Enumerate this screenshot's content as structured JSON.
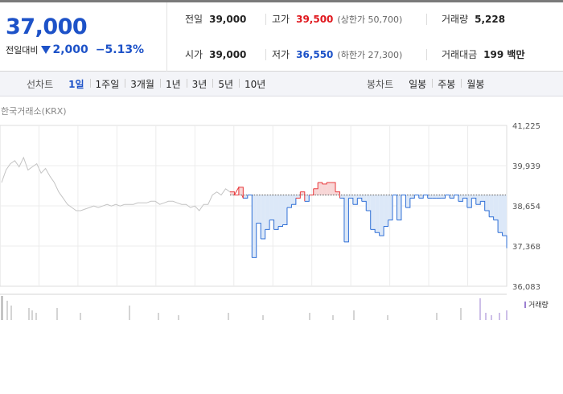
{
  "quote": {
    "price": "37,000",
    "change_label": "전일대비",
    "change_value": "2,000",
    "change_pct": "−5.13%",
    "prev_close_label": "전일",
    "prev_close": "39,000",
    "high_label": "고가",
    "high": "39,500",
    "upper_limit": "(상한가 50,700)",
    "volume_label": "거래량",
    "volume": "5,228",
    "open_label": "시가",
    "open": "39,000",
    "low_label": "저가",
    "low": "36,550",
    "lower_limit": "(하한가 27,300)",
    "trade_value_label": "거래대금",
    "trade_value": "199 백만"
  },
  "tabs": {
    "line_chart_label": "선차트",
    "line_periods": [
      "1일",
      "1주일",
      "3개월",
      "1년",
      "3년",
      "5년",
      "10년"
    ],
    "active_period": "1일",
    "candle_chart_label": "봉차트",
    "candle_periods": [
      "일봉",
      "주봉",
      "월봉"
    ]
  },
  "chart": {
    "exchange_label": "한국거래소(KRX)",
    "volume_legend": "거래량",
    "colors": {
      "up": "#e8393c",
      "down": "#2f6fd6",
      "fill_down": "#dce8f8",
      "fill_up": "#f8d6d6",
      "neutral": "#c4c4c4",
      "volume": "#9b7fd1"
    }
  },
  "chart_data": {
    "type": "line",
    "title": "",
    "xlabel": "",
    "ylabel": "",
    "ylim": [
      36083,
      41225
    ],
    "y_ticks": [
      "41,225",
      "39,939",
      "38,654",
      "37,368",
      "36,083"
    ],
    "reference_price": 39000,
    "series": [
      {
        "values": [
          39400,
          39800,
          40000,
          40100,
          39900,
          40200,
          39800,
          39900,
          40000,
          39700,
          39850,
          39600,
          39400,
          39100,
          38900,
          38700,
          38600,
          38500,
          38500,
          38550,
          38600,
          38650,
          38600,
          38650,
          38700,
          38650,
          38700,
          38650,
          38700,
          38700,
          38700,
          38750,
          38750,
          38750,
          38800,
          38800,
          38700,
          38750,
          38800,
          38800,
          38750,
          38700,
          38700,
          38600,
          38650,
          38500,
          38700,
          38700,
          39000,
          39100,
          39000,
          39200,
          39100,
          39000,
          39250,
          38900,
          39000,
          37000,
          38100,
          37600,
          37900,
          38200,
          37900,
          38000,
          38050,
          38600,
          38700,
          38900,
          39100,
          38800,
          39000,
          39200,
          39400,
          39350,
          39400,
          39400,
          39100,
          38900,
          37500,
          38900,
          38700,
          38900,
          38800,
          38500,
          37900,
          37800,
          37700,
          38000,
          38200,
          39000,
          38200,
          39000,
          38600,
          38900,
          39000,
          38900,
          39000,
          38900,
          38900,
          38900,
          38900,
          39000,
          38900,
          39000,
          38800,
          38900,
          38600,
          38900,
          38700,
          38800,
          38500,
          38300,
          38200,
          37800,
          37700,
          37300
        ]
      }
    ],
    "volume_bars": [
      1,
      1,
      0.8,
      0.6,
      0.5,
      0.4,
      0.3,
      0.5,
      0.3,
      0.6,
      0.3,
      0.2,
      0.3,
      0.2,
      0.3,
      0.2,
      0.4,
      0.2,
      0.3,
      0.5,
      0.9,
      0.3,
      0.2,
      0.3,
      0.4
    ]
  }
}
